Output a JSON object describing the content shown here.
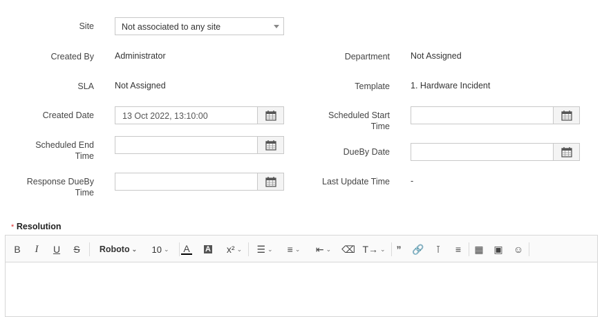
{
  "form": {
    "site": {
      "label": "Site",
      "value": "Not associated to any site"
    },
    "created_by": {
      "label": "Created By",
      "value": "Administrator"
    },
    "department": {
      "label": "Department",
      "value": "Not Assigned"
    },
    "sla": {
      "label": "SLA",
      "value": "Not Assigned"
    },
    "template": {
      "label": "Template",
      "value": "1. Hardware Incident"
    },
    "created_date": {
      "label": "Created Date",
      "value": "13 Oct 2022, 13:10:00"
    },
    "scheduled_start": {
      "label_line1": "Scheduled Start",
      "label_line2": "Time",
      "value": ""
    },
    "scheduled_end": {
      "label_line1": "Scheduled End",
      "label_line2": "Time",
      "value": ""
    },
    "dueby_date": {
      "label": "DueBy Date",
      "value": ""
    },
    "response_dueby": {
      "label_line1": "Response DueBy",
      "label_line2": "Time",
      "value": ""
    },
    "last_update": {
      "label": "Last Update Time",
      "value": "-"
    }
  },
  "resolution": {
    "required_mark": "*",
    "label": "Resolution",
    "toolbar": {
      "bold": "B",
      "italic": "I",
      "underline": "U",
      "strike": "S",
      "font_family": "Roboto",
      "font_size": "10",
      "font_color": "A",
      "bg_color": "A",
      "superscript": "x²"
    }
  },
  "icons": [
    "calendar-icon",
    "caret-down-icon",
    "align-icon",
    "bullet-list-icon",
    "indent-icon",
    "eraser-icon",
    "clear-format-icon",
    "quote-icon",
    "link-icon",
    "unlink-icon",
    "horizontal-rule-icon",
    "table-icon",
    "image-icon",
    "emoji-icon"
  ],
  "colors": {
    "required": "#e03131",
    "border": "#c8c8c8",
    "font_color_bar": "#000000"
  }
}
